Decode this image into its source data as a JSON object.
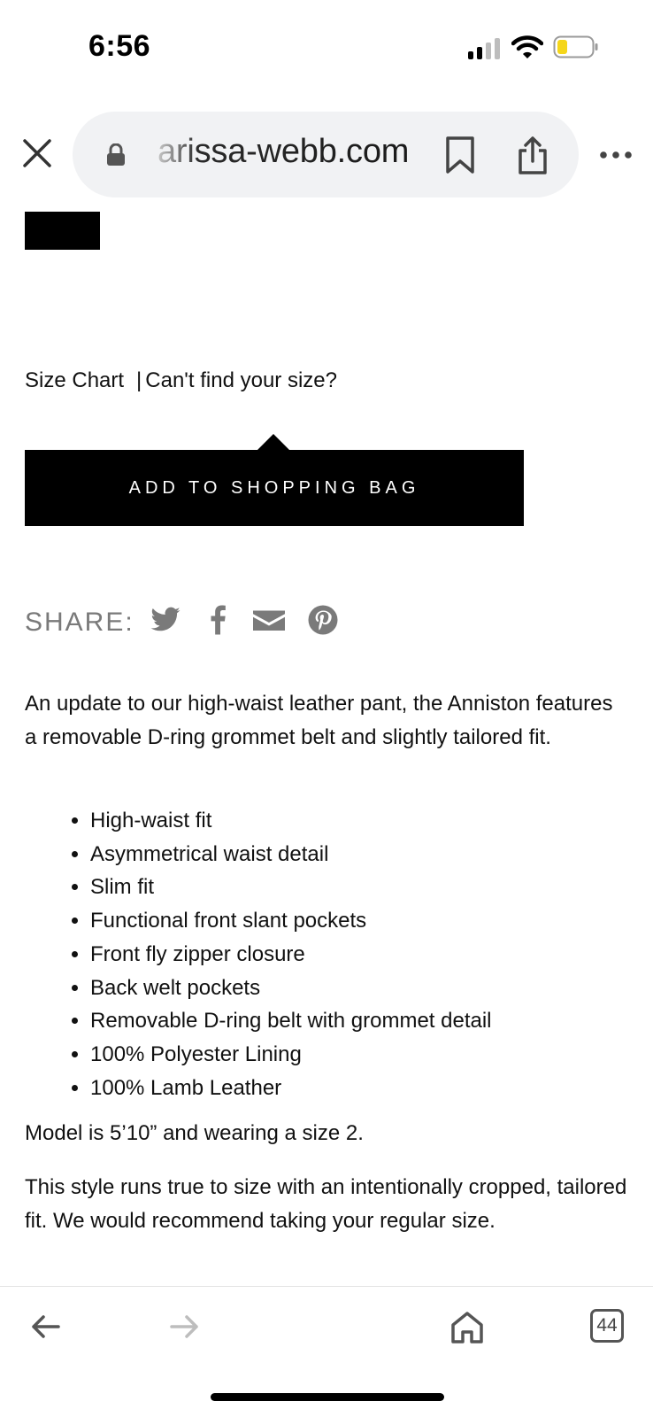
{
  "status_bar": {
    "time": "6:56"
  },
  "browser": {
    "url": "arissa-webb.com"
  },
  "product": {
    "size_chart_label": "Size Chart",
    "size_separator": "|",
    "size_help_label": "Can't find your size?",
    "add_to_bag_label": "ADD TO SHOPPING BAG",
    "share_label": "SHARE:",
    "description": "An update to our high-waist leather pant, the Anniston features a removable D-ring grommet belt and slightly tailored fit.",
    "features": [
      "High-waist fit",
      "Asymmetrical waist detail",
      "Slim fit",
      "Functional front slant pockets",
      "Front fly zipper closure",
      "Back welt pockets",
      "Removable D-ring belt with grommet detail",
      "100% Polyester Lining",
      "100% Lamb Leather"
    ],
    "model_info": "Model is 5’10” and wearing a size 2.",
    "fit_info": "This style runs true to size with an intentionally cropped, tailored fit. We would recommend taking your regular size."
  },
  "toolbar": {
    "tab_count": "44"
  },
  "colors": {
    "button_bg": "#000000",
    "button_text": "#ffffff",
    "url_pill_bg": "#f1f2f4",
    "share_icon": "#7a7a7a",
    "battery_fill": "#f5d61a"
  },
  "icons": [
    "signal-icon",
    "wifi-icon",
    "battery-icon",
    "close-icon",
    "lock-icon",
    "bookmark-icon",
    "share-icon",
    "more-icon",
    "twitter-icon",
    "facebook-icon",
    "email-icon",
    "pinterest-icon",
    "back-arrow-icon",
    "forward-arrow-icon",
    "home-icon",
    "tabs-icon"
  ]
}
